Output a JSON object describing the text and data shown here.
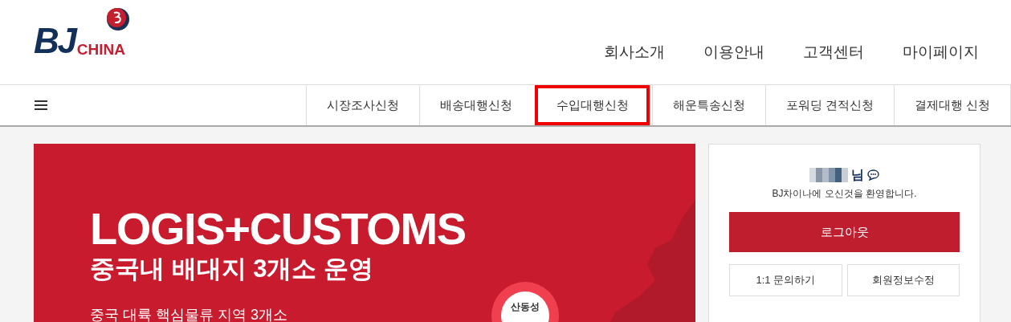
{
  "logo": {
    "main": "BJ",
    "sub": "CHINA"
  },
  "top_menu": [
    "회사소개",
    "이용안내",
    "고객센터",
    "마이페이지"
  ],
  "tabs": [
    {
      "label": "시장조사신청",
      "selected": false
    },
    {
      "label": "배송대행신청",
      "selected": false
    },
    {
      "label": "수입대행신청",
      "selected": true
    },
    {
      "label": "해운특송신청",
      "selected": false
    },
    {
      "label": "포워딩 견적신청",
      "selected": false
    },
    {
      "label": "결제대행 신청",
      "selected": false
    }
  ],
  "banner": {
    "title": "LOGIS+CUSTOMS",
    "subtitle": "중국내 배대지 3개소 운영",
    "body": "중국 대륙 핵심물류 지역 3개소",
    "badge": "산동성"
  },
  "user_card": {
    "suffix": "님",
    "welcome": "BJ차이나에 오신것을 환영합니다.",
    "logout": "로그아웃",
    "buttons": [
      "1:1 문의하기",
      "회원정보수정"
    ]
  }
}
